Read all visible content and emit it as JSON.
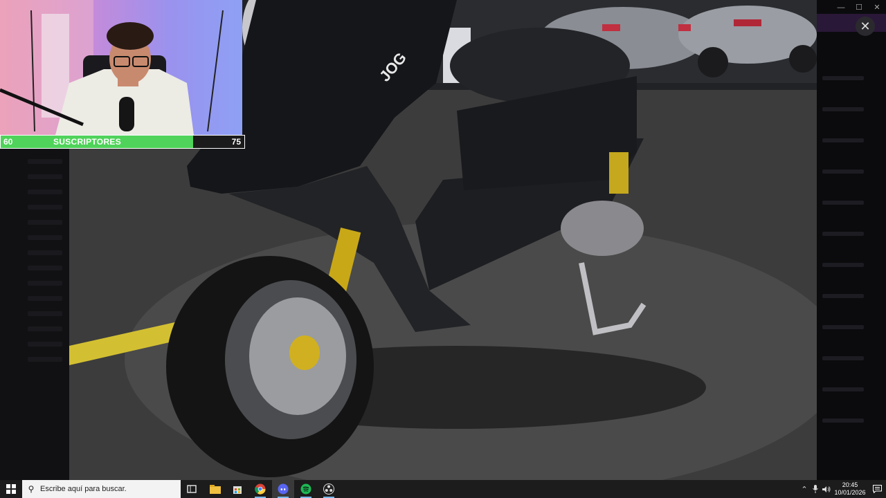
{
  "window": {
    "minimize_icon": "minimize-icon",
    "maximize_icon": "maximize-icon",
    "close_icon": "close-icon",
    "minimize": "—",
    "maximize": "☐",
    "close": "✕"
  },
  "viewer": {
    "close_label": "✕"
  },
  "webcam": {
    "description_icon": "webcam-overlay"
  },
  "sub_goal": {
    "start": "60",
    "label": "SUSCRIPTORES",
    "end": "75",
    "progress_fraction": 0.79,
    "fill_color": "#4fd35a"
  },
  "taskbar": {
    "search_placeholder": "Escribe aquí para buscar.",
    "apps": [
      "task-view-icon",
      "file-explorer-icon",
      "store-icon",
      "chrome-icon",
      "discord-icon",
      "spotify-icon",
      "obs-icon"
    ],
    "time": "20:45",
    "date": "10/01/2026"
  },
  "colors": {
    "accent_green": "#4fd35a",
    "taskbar": "#1c1c1c",
    "search_bg": "#f3f3f3"
  }
}
